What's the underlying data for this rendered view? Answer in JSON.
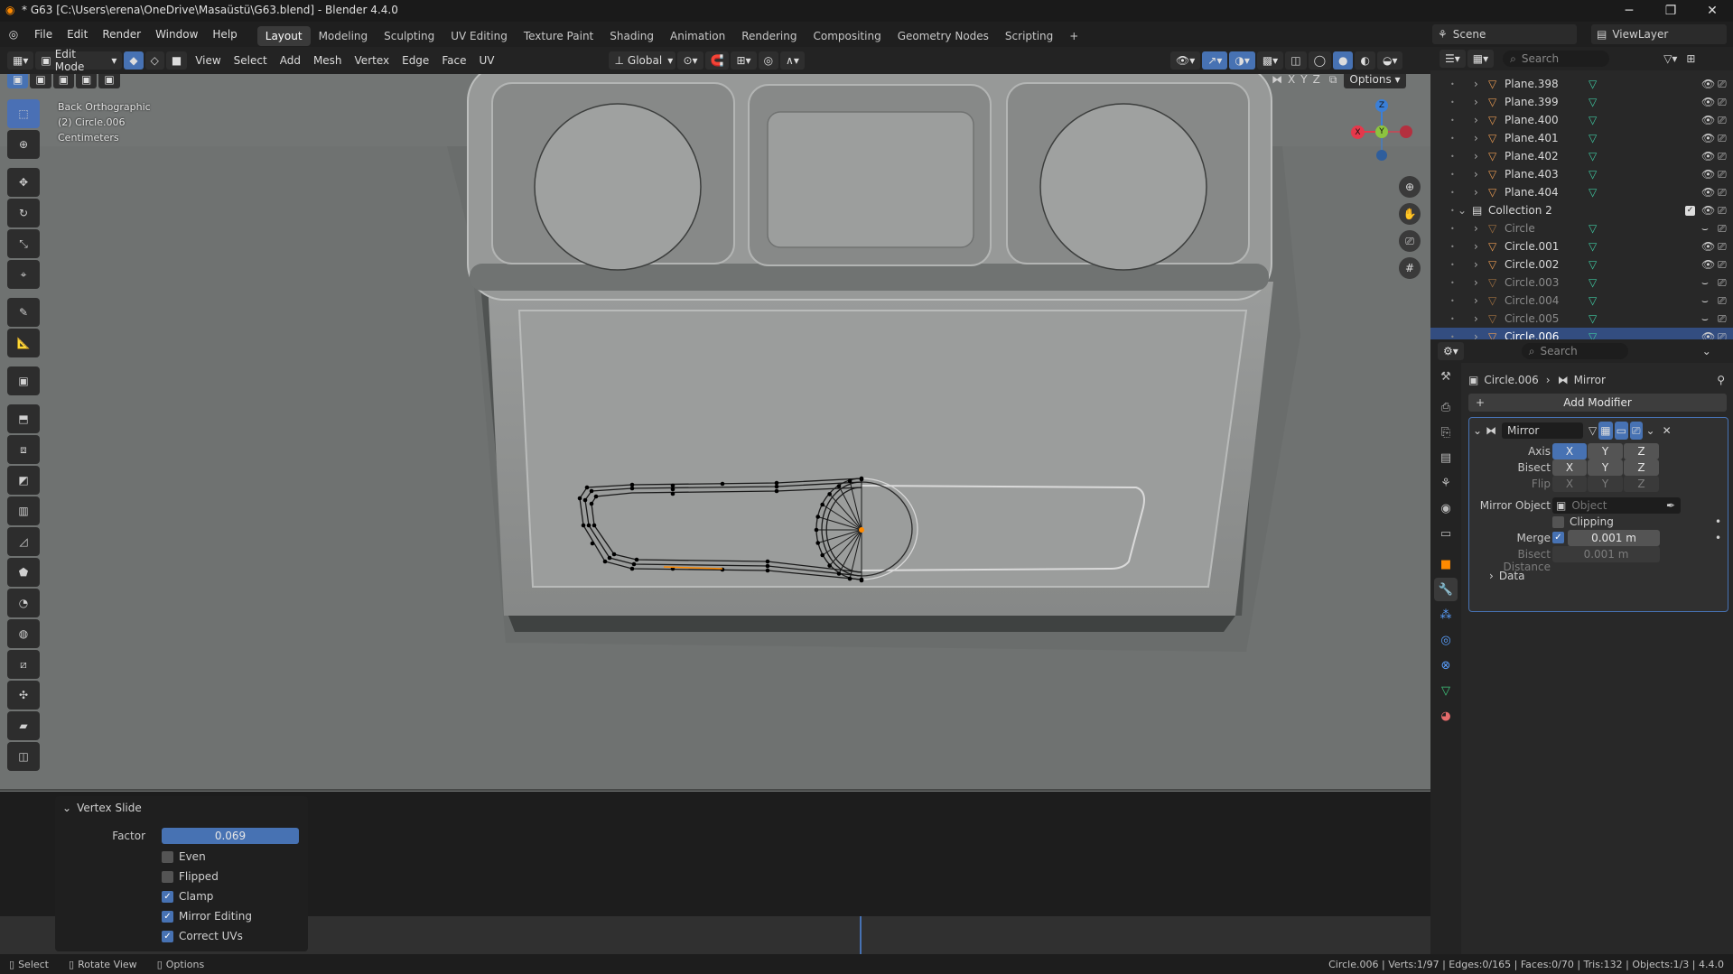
{
  "window": {
    "title": "* G63 [C:\\Users\\erena\\OneDrive\\Masaüstü\\G63.blend] - Blender 4.4.0"
  },
  "menu": [
    "File",
    "Edit",
    "Render",
    "Window",
    "Help"
  ],
  "workspaces": [
    "Layout",
    "Modeling",
    "Sculpting",
    "UV Editing",
    "Texture Paint",
    "Shading",
    "Animation",
    "Rendering",
    "Compositing",
    "Geometry Nodes",
    "Scripting"
  ],
  "scene": {
    "label": "Scene",
    "viewlayer": "ViewLayer"
  },
  "header": {
    "mode": "Edit Mode",
    "menus": [
      "View",
      "Select",
      "Add",
      "Mesh",
      "Vertex",
      "Edge",
      "Face",
      "UV"
    ],
    "orientation": "Global",
    "options": "Options",
    "axes": [
      "X",
      "Y",
      "Z"
    ]
  },
  "viewport": {
    "view": "Back Orthographic",
    "object": "(2) Circle.006",
    "units": "Centimeters"
  },
  "gizmo": {
    "x": "X",
    "y": "Y",
    "z": "Z"
  },
  "redo": {
    "title": "Vertex Slide",
    "factor_label": "Factor",
    "factor": "0.069",
    "options": [
      {
        "label": "Even",
        "on": false
      },
      {
        "label": "Flipped",
        "on": false
      },
      {
        "label": "Clamp",
        "on": true
      },
      {
        "label": "Mirror Editing",
        "on": true
      },
      {
        "label": "Correct UVs",
        "on": true
      }
    ]
  },
  "outliner": {
    "search": "Search",
    "rows": [
      {
        "name": "Plane.398",
        "indent": 1,
        "dim": false
      },
      {
        "name": "Plane.399",
        "indent": 1,
        "dim": false
      },
      {
        "name": "Plane.400",
        "indent": 1,
        "dim": false
      },
      {
        "name": "Plane.401",
        "indent": 1,
        "dim": false
      },
      {
        "name": "Plane.402",
        "indent": 1,
        "dim": false
      },
      {
        "name": "Plane.403",
        "indent": 1,
        "dim": false
      },
      {
        "name": "Plane.404",
        "indent": 1,
        "dim": false
      },
      {
        "name": "Collection 2",
        "indent": 0,
        "dim": false
      },
      {
        "name": "Circle",
        "indent": 1,
        "dim": true
      },
      {
        "name": "Circle.001",
        "indent": 1,
        "dim": false
      },
      {
        "name": "Circle.002",
        "indent": 1,
        "dim": false
      },
      {
        "name": "Circle.003",
        "indent": 1,
        "dim": true
      },
      {
        "name": "Circle.004",
        "indent": 1,
        "dim": true
      },
      {
        "name": "Circle.005",
        "indent": 1,
        "dim": true
      },
      {
        "name": "Circle.006",
        "indent": 1,
        "dim": false,
        "selected": true
      }
    ]
  },
  "properties": {
    "search": "Search",
    "breadcrumb_object": "Circle.006",
    "breadcrumb_modifier": "Mirror",
    "add_modifier": "Add Modifier",
    "modifier_name": "Mirror",
    "axis_label": "Axis",
    "bisect_label": "Bisect",
    "flip_label": "Flip",
    "xyz": [
      "X",
      "Y",
      "Z"
    ],
    "mirror_object_label": "Mirror Object",
    "mirror_object_placeholder": "Object",
    "clipping": "Clipping",
    "merge_label": "Merge",
    "merge_value": "0.001 m",
    "bisect_distance_label": "Bisect Distance",
    "bisect_distance_value": "0.001 m",
    "data": "Data"
  },
  "status": {
    "select": "Select",
    "rotate": "Rotate View",
    "options": "Options",
    "stats": "Circle.006 | Verts:1/97 | Edges:0/165 | Faces:0/70 | Tris:132 | Objects:1/3 | 4.4.0"
  },
  "colors": {
    "accent": "#4772b3",
    "active_vertex": "#ff8a00",
    "x_axis": "#e5384b",
    "y_axis": "#8cc43f",
    "z_axis": "#3b7fd6"
  }
}
